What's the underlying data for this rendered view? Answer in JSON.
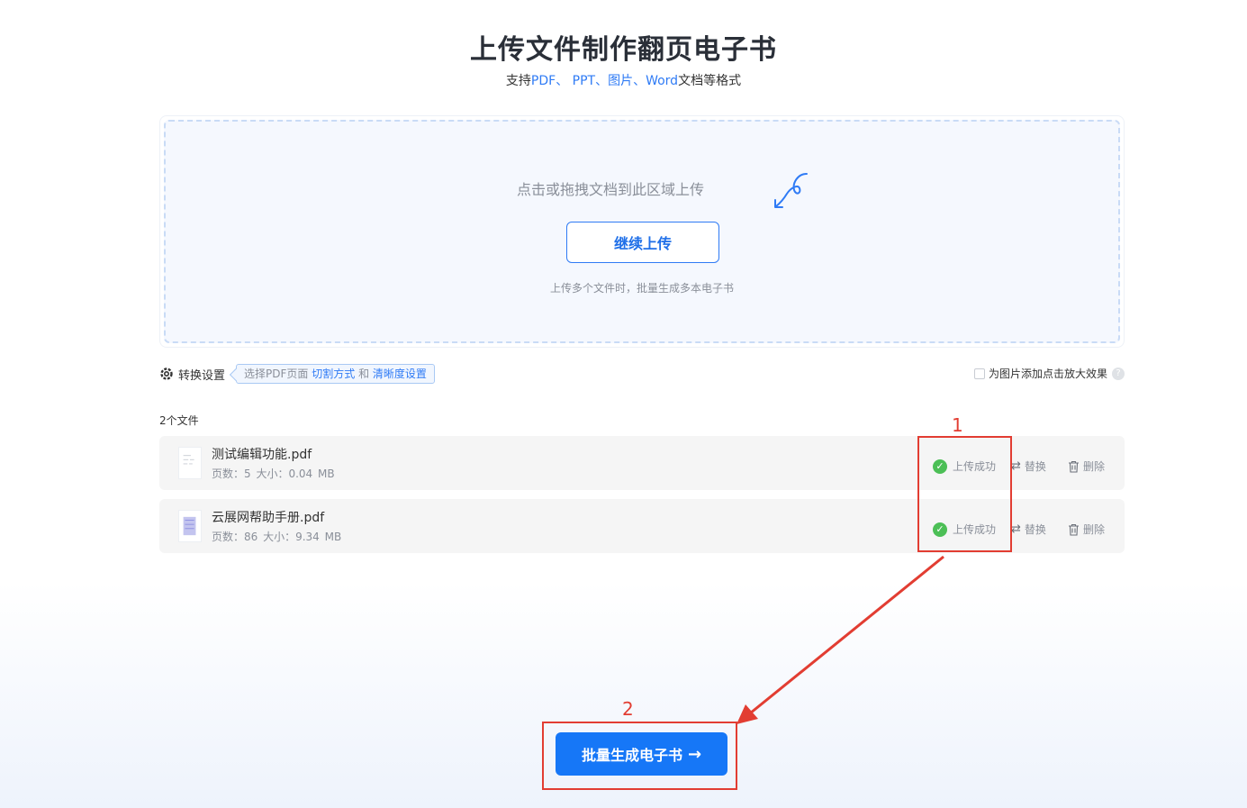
{
  "header": {
    "title": "上传文件制作翻页电子书",
    "subtitle_prefix": "支持",
    "subtitle_formats": "PDF、 PPT、图片、Word",
    "subtitle_suffix": "文档等格式"
  },
  "upload": {
    "hint": "点击或拖拽文档到此区域上传",
    "continue_label": "继续上传",
    "note": "上传多个文件时，批量生成多本电子书"
  },
  "settings": {
    "label": "转换设置",
    "tag_prefix": "选择PDF页面",
    "tag_link1": "切割方式",
    "tag_mid": "和",
    "tag_link2": "清晰度设置",
    "zoom_option": "为图片添加点击放大效果",
    "zoom_checked": false
  },
  "files": {
    "count_label": "2个文件",
    "items": [
      {
        "name": "测试编辑功能.pdf",
        "meta": "页数：5  大小：0.04 MB",
        "status": "上传成功",
        "replace": "替换",
        "delete": "删除"
      },
      {
        "name": "云展网帮助手册.pdf",
        "meta": "页数：86  大小：9.34 MB",
        "status": "上传成功",
        "replace": "替换",
        "delete": "删除"
      }
    ]
  },
  "annotations": {
    "num1": "1",
    "num2": "2",
    "color": "#e23d32"
  },
  "batch_button": {
    "label": "批量生成电子书",
    "arrow": "→"
  },
  "colors": {
    "accent": "#1677f7",
    "success": "#4cbf56"
  }
}
